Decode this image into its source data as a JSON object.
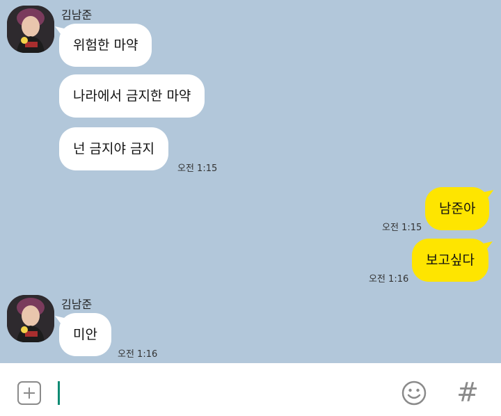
{
  "chat": {
    "groups": [
      {
        "sender": "김남준",
        "messages": [
          "위험한 마약",
          "나라에서 금지한 마약",
          "넌 금지야 금지"
        ],
        "time": "오전 1:15"
      },
      {
        "sender": "me",
        "messages": [
          "남준아"
        ],
        "time": "오전 1:15"
      },
      {
        "sender": "me",
        "messages": [
          "보고싶다"
        ],
        "time": "오전 1:16"
      },
      {
        "sender": "김남준",
        "messages": [
          "미안"
        ],
        "time": "오전 1:16"
      }
    ]
  },
  "input_bar": {
    "value": "",
    "hash_label": "#",
    "icons": [
      "plus-icon",
      "emoji-icon",
      "hash-icon"
    ]
  },
  "colors": {
    "chat_background": "#b2c7da",
    "my_bubble": "#fee500",
    "their_bubble": "#ffffff",
    "cursor": "#0b8a73"
  }
}
